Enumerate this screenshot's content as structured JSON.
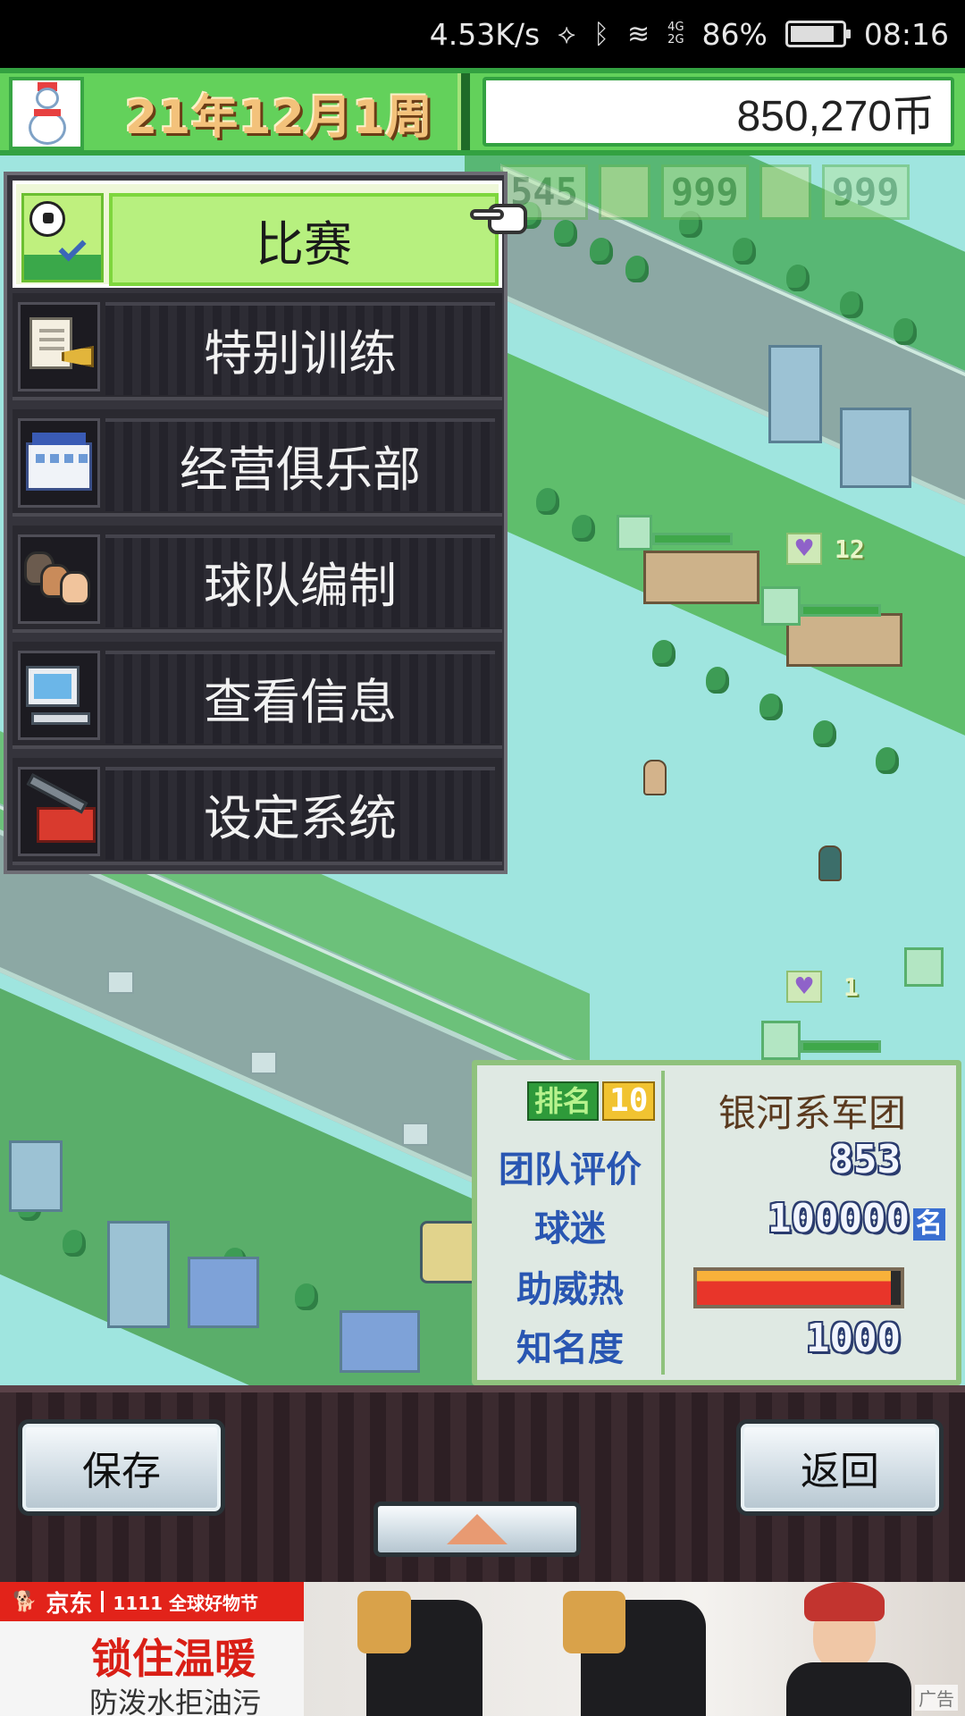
{
  "status_bar": {
    "net_speed": "4.53K/s",
    "battery_percent": "86%",
    "battery_level": 0.86,
    "time": "08:16",
    "net_type_top": "4G",
    "net_type_bottom": "2G"
  },
  "hud": {
    "date": "21年12月1周",
    "coins": "850,270币"
  },
  "stats_strip": [
    "545",
    "999",
    "999"
  ],
  "menu": {
    "items": [
      {
        "label": "比赛",
        "icon": "soccer-ball-check-icon",
        "selected": true
      },
      {
        "label": "特别训练",
        "icon": "training-document-horn-icon",
        "selected": false
      },
      {
        "label": "经营俱乐部",
        "icon": "clubhouse-icon",
        "selected": false
      },
      {
        "label": "球队编制",
        "icon": "players-icon",
        "selected": false
      },
      {
        "label": "查看信息",
        "icon": "computer-icon",
        "selected": false
      },
      {
        "label": "设定系统",
        "icon": "toolbox-wrench-icon",
        "selected": false
      }
    ]
  },
  "scene": {
    "heart_counts": [
      "12",
      "1"
    ]
  },
  "team_panel": {
    "rank_label": "排名",
    "rank": "10",
    "team_name": "银河系军团",
    "rating_label": "团队评价",
    "rating": "853",
    "fans_label": "球迷",
    "fans": "100000",
    "fans_unit": "名",
    "cheer_label": "助威热",
    "cheer_level": 0.95,
    "fame_label": "知名度",
    "fame": "1000"
  },
  "controls": {
    "save_label": "保存",
    "back_label": "返回",
    "expand_icon": "arrow-up-icon"
  },
  "ad": {
    "brand": "京东",
    "event": "1111 全球好物节",
    "title": "锁住温暖",
    "subtitle": "防泼水拒油污",
    "tag": "广告"
  },
  "colors": {
    "hud_green": "#63d15b",
    "menu_selected": "#b7f07f",
    "panel_blue_text": "#2956b2",
    "ad_red": "#e2231a"
  }
}
